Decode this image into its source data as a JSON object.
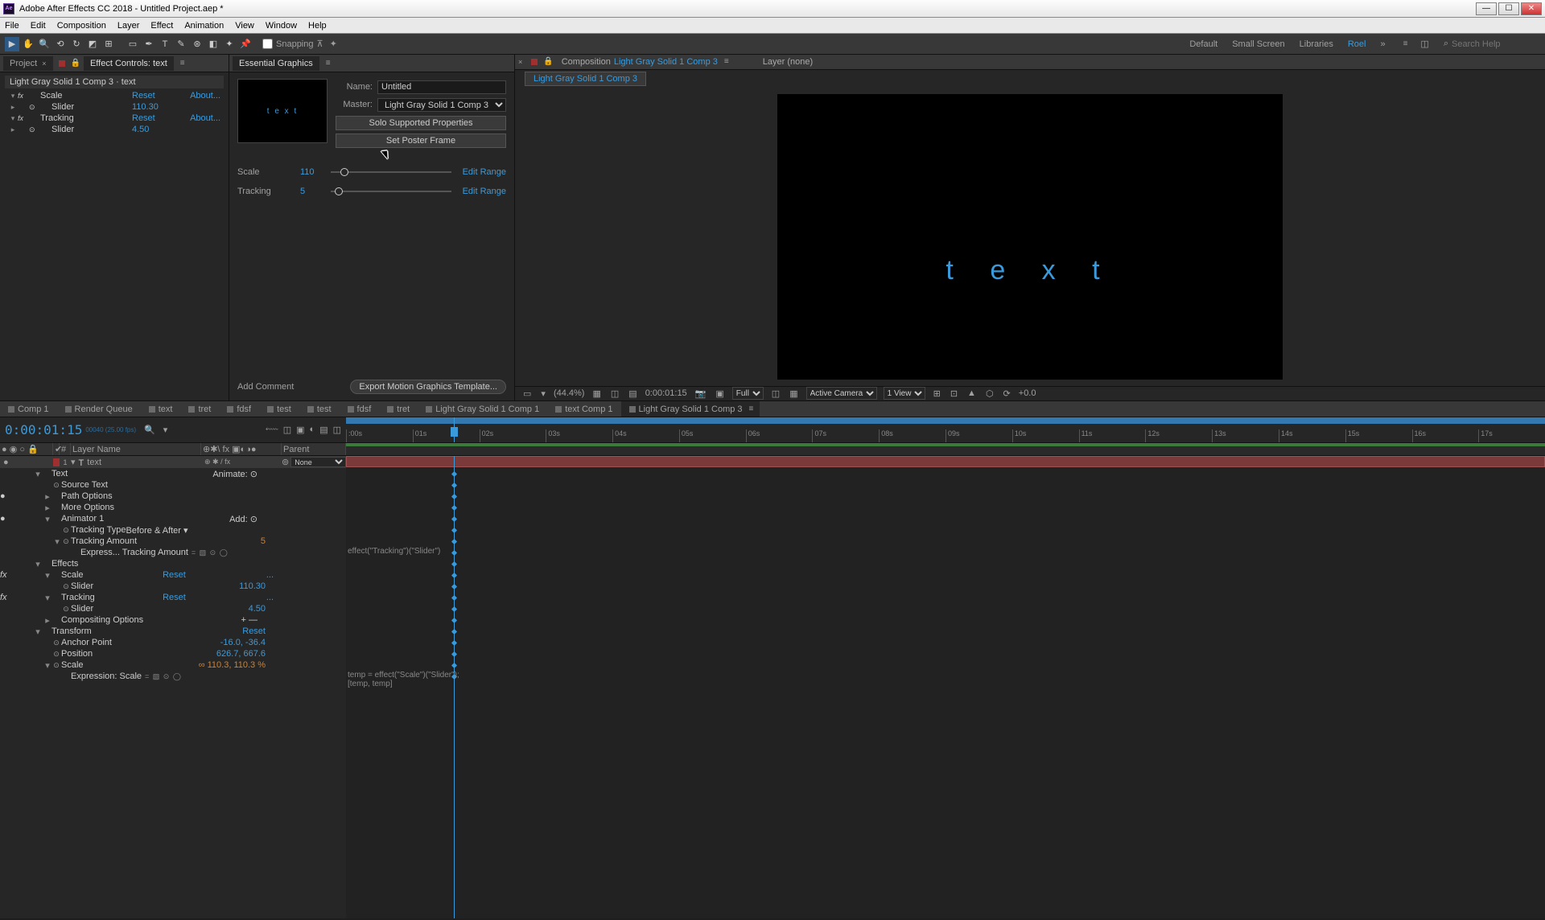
{
  "titlebar": {
    "app_icon": "Ae",
    "title": "Adobe After Effects CC 2018 - Untitled Project.aep *"
  },
  "menubar": [
    "File",
    "Edit",
    "Composition",
    "Layer",
    "Effect",
    "Animation",
    "View",
    "Window",
    "Help"
  ],
  "toolbar": {
    "snapping_label": "Snapping",
    "workspaces": [
      "Default",
      "Small Screen",
      "Libraries"
    ],
    "user": "Roel",
    "search_placeholder": "Search Help"
  },
  "left_panel": {
    "tabs": {
      "project": "Project",
      "effect_controls": "Effect Controls: text"
    },
    "title": "Light Gray Solid 1 Comp 3 · text",
    "rows": [
      {
        "tw": "▾",
        "fx": "fx",
        "eye": "",
        "name": "Scale",
        "link": "Reset",
        "about": "About..."
      },
      {
        "tw": "▸",
        "fx": "",
        "eye": "⊙",
        "name": "Slider",
        "link": "110.30",
        "about": ""
      },
      {
        "tw": "▾",
        "fx": "fx",
        "eye": "",
        "name": "Tracking",
        "link": "Reset",
        "about": "About..."
      },
      {
        "tw": "▸",
        "fx": "",
        "eye": "⊙",
        "name": "Slider",
        "link": "4.50",
        "about": ""
      }
    ]
  },
  "essential_graphics": {
    "tab": "Essential Graphics",
    "preview_text": "t e x t",
    "name_label": "Name:",
    "name_value": "Untitled",
    "master_label": "Master:",
    "master_value": "Light Gray Solid 1 Comp 3",
    "solo_btn": "Solo Supported Properties",
    "poster_btn": "Set Poster Frame",
    "sliders": [
      {
        "label": "Scale",
        "value": "110",
        "thumb_pct": 8,
        "edit": "Edit Range"
      },
      {
        "label": "Tracking",
        "value": "5",
        "thumb_pct": 3,
        "edit": "Edit Range"
      }
    ],
    "add_comment": "Add Comment",
    "export_btn": "Export Motion Graphics Template..."
  },
  "composition": {
    "tab_prefix": "Composition",
    "tab_name": "Light Gray Solid 1 Comp 3",
    "layer_label": "Layer",
    "layer_value": "(none)",
    "breadcrumb": "Light Gray Solid 1 Comp 3",
    "canvas_text": "t e x t"
  },
  "viewer_toolbar": {
    "mag": "(44.4%)",
    "time": "0:00:01:15",
    "res": "Full",
    "camera": "Active Camera",
    "view": "1 View",
    "exposure": "+0.0"
  },
  "timeline": {
    "tabs": [
      "Comp 1",
      "Render Queue",
      "text",
      "tret",
      "fdsf",
      "test",
      "test",
      "fdsf",
      "tret",
      "Light Gray Solid 1 Comp 1",
      "text Comp 1",
      "Light Gray Solid 1 Comp 3"
    ],
    "active_tab_index": 11,
    "timecode": "0:00:01:15",
    "timecode_sub": "00040 (25.00 fps)",
    "ruler_marks": [
      ":00s",
      "01s",
      "02s",
      "03s",
      "04s",
      "05s",
      "06s",
      "07s",
      "08s",
      "09s",
      "10s",
      "11s",
      "12s",
      "13s",
      "14s",
      "15s",
      "16s",
      "17s"
    ],
    "playhead_pct": 9,
    "col_headers": {
      "num": "#",
      "layer_name": "Layer Name",
      "switches": "⊕✱\\ fx ▣◐◑●",
      "parent": "Parent"
    },
    "layer": {
      "num": "1",
      "icon": "T",
      "name": "text",
      "switches": "⊕ ✱ / fx",
      "parent": "None"
    },
    "props": [
      {
        "ind": 2,
        "tw": "▾",
        "name": "Text",
        "right": "Animate: ⊙",
        "right_at": "switches"
      },
      {
        "ind": 3,
        "sw": "⊙",
        "name": "Source Text"
      },
      {
        "ind": 3,
        "tw": "▸",
        "name": "Path Options",
        "vis": "●"
      },
      {
        "ind": 3,
        "tw": "▸",
        "name": "More Options"
      },
      {
        "ind": 3,
        "tw": "▾",
        "name": "Animator 1",
        "right": "Add: ⊙",
        "right_at": "switches",
        "vis": "●"
      },
      {
        "ind": 4,
        "sw": "⊙",
        "name": "Tracking Type",
        "val": "Before & After ▾",
        "val_plain": true
      },
      {
        "ind": 4,
        "tw": "▾",
        "sw": "⊙",
        "name": "Tracking Amount",
        "val": "5",
        "val_orange": true
      },
      {
        "ind": 5,
        "name": "Express... Tracking Amount",
        "extras": "= ▧ ⊙ ◯",
        "expr_in_track": "effect(\"Tracking\")(\"Slider\")"
      },
      {
        "ind": 2,
        "tw": "▾",
        "name": "Effects"
      },
      {
        "ind": 3,
        "tw": "▾",
        "name": "Scale",
        "val": "Reset",
        "val_link": true,
        "fx": "fx",
        "dots": "..."
      },
      {
        "ind": 4,
        "sw": "⊙",
        "name": "Slider",
        "val": "110.30"
      },
      {
        "ind": 3,
        "tw": "▾",
        "name": "Tracking",
        "val": "Reset",
        "val_link": true,
        "fx": "fx",
        "dots": "..."
      },
      {
        "ind": 4,
        "sw": "⊙",
        "name": "Slider",
        "val": "4.50"
      },
      {
        "ind": 3,
        "tw": "▸",
        "name": "Compositing Options",
        "right": "+ —",
        "right_at": "switches"
      },
      {
        "ind": 2,
        "tw": "▾",
        "name": "Transform",
        "val": "Reset",
        "val_link": true
      },
      {
        "ind": 3,
        "sw": "⊙",
        "name": "Anchor Point",
        "val": "-16.0, -36.4"
      },
      {
        "ind": 3,
        "sw": "⊙",
        "name": "Position",
        "val": "626.7, 667.6"
      },
      {
        "ind": 3,
        "tw": "▾",
        "sw": "⊙",
        "name": "Scale",
        "val": "∞ 110.3, 110.3 %",
        "val_orange": true
      },
      {
        "ind": 4,
        "name": "Expression: Scale",
        "extras": "= ▧ ⊙ ◯",
        "expr_in_track": "temp = effect(\"Scale\")(\"Slider\");\n[temp, temp]"
      }
    ]
  }
}
